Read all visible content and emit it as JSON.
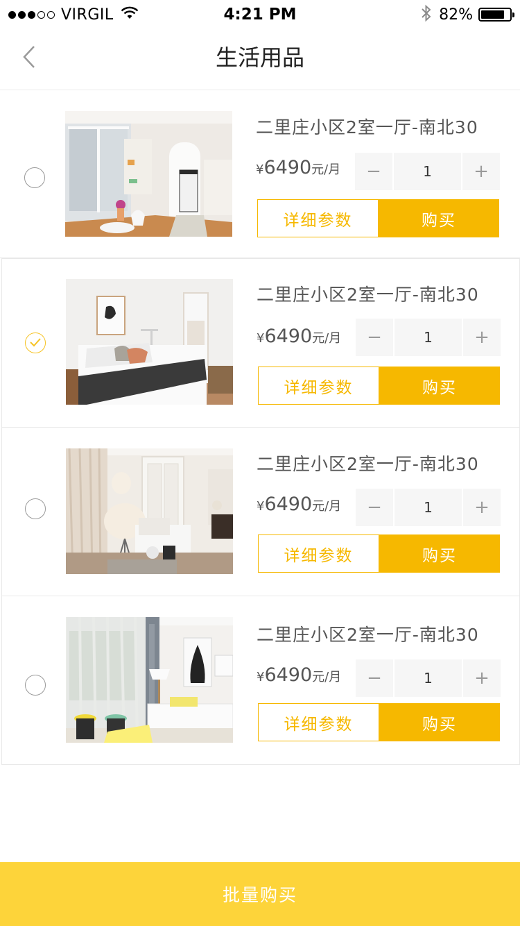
{
  "status_bar": {
    "carrier": "VIRGIL",
    "time": "4:21 PM",
    "battery": "82%",
    "battery_level": 0.82,
    "signal_dots": [
      "full",
      "full",
      "full",
      "empty",
      "empty"
    ]
  },
  "nav": {
    "title": "生活用品",
    "back_icon": "chevron-left-icon"
  },
  "items": [
    {
      "title": "二里庄小区2室一厅-南北30",
      "currency": "¥",
      "price": "6490",
      "unit": "元/月",
      "minus": "−",
      "quantity": "1",
      "plus": "+",
      "detail_label": "详细参数",
      "buy_label": "购买",
      "selected": false
    },
    {
      "title": "二里庄小区2室一厅-南北30",
      "currency": "¥",
      "price": "6490",
      "unit": "元/月",
      "minus": "−",
      "quantity": "1",
      "plus": "+",
      "detail_label": "详细参数",
      "buy_label": "购买",
      "selected": true
    },
    {
      "title": "二里庄小区2室一厅-南北30",
      "currency": "¥",
      "price": "6490",
      "unit": "元/月",
      "minus": "−",
      "quantity": "1",
      "plus": "+",
      "detail_label": "详细参数",
      "buy_label": "购买",
      "selected": false
    },
    {
      "title": "二里庄小区2室一厅-南北30",
      "currency": "¥",
      "price": "6490",
      "unit": "元/月",
      "minus": "−",
      "quantity": "1",
      "plus": "+",
      "detail_label": "详细参数",
      "buy_label": "购买",
      "selected": false
    }
  ],
  "footer": {
    "batch_buy_label": "批量购买"
  },
  "colors": {
    "accent": "#f6b800",
    "footer": "#fdd43a"
  }
}
